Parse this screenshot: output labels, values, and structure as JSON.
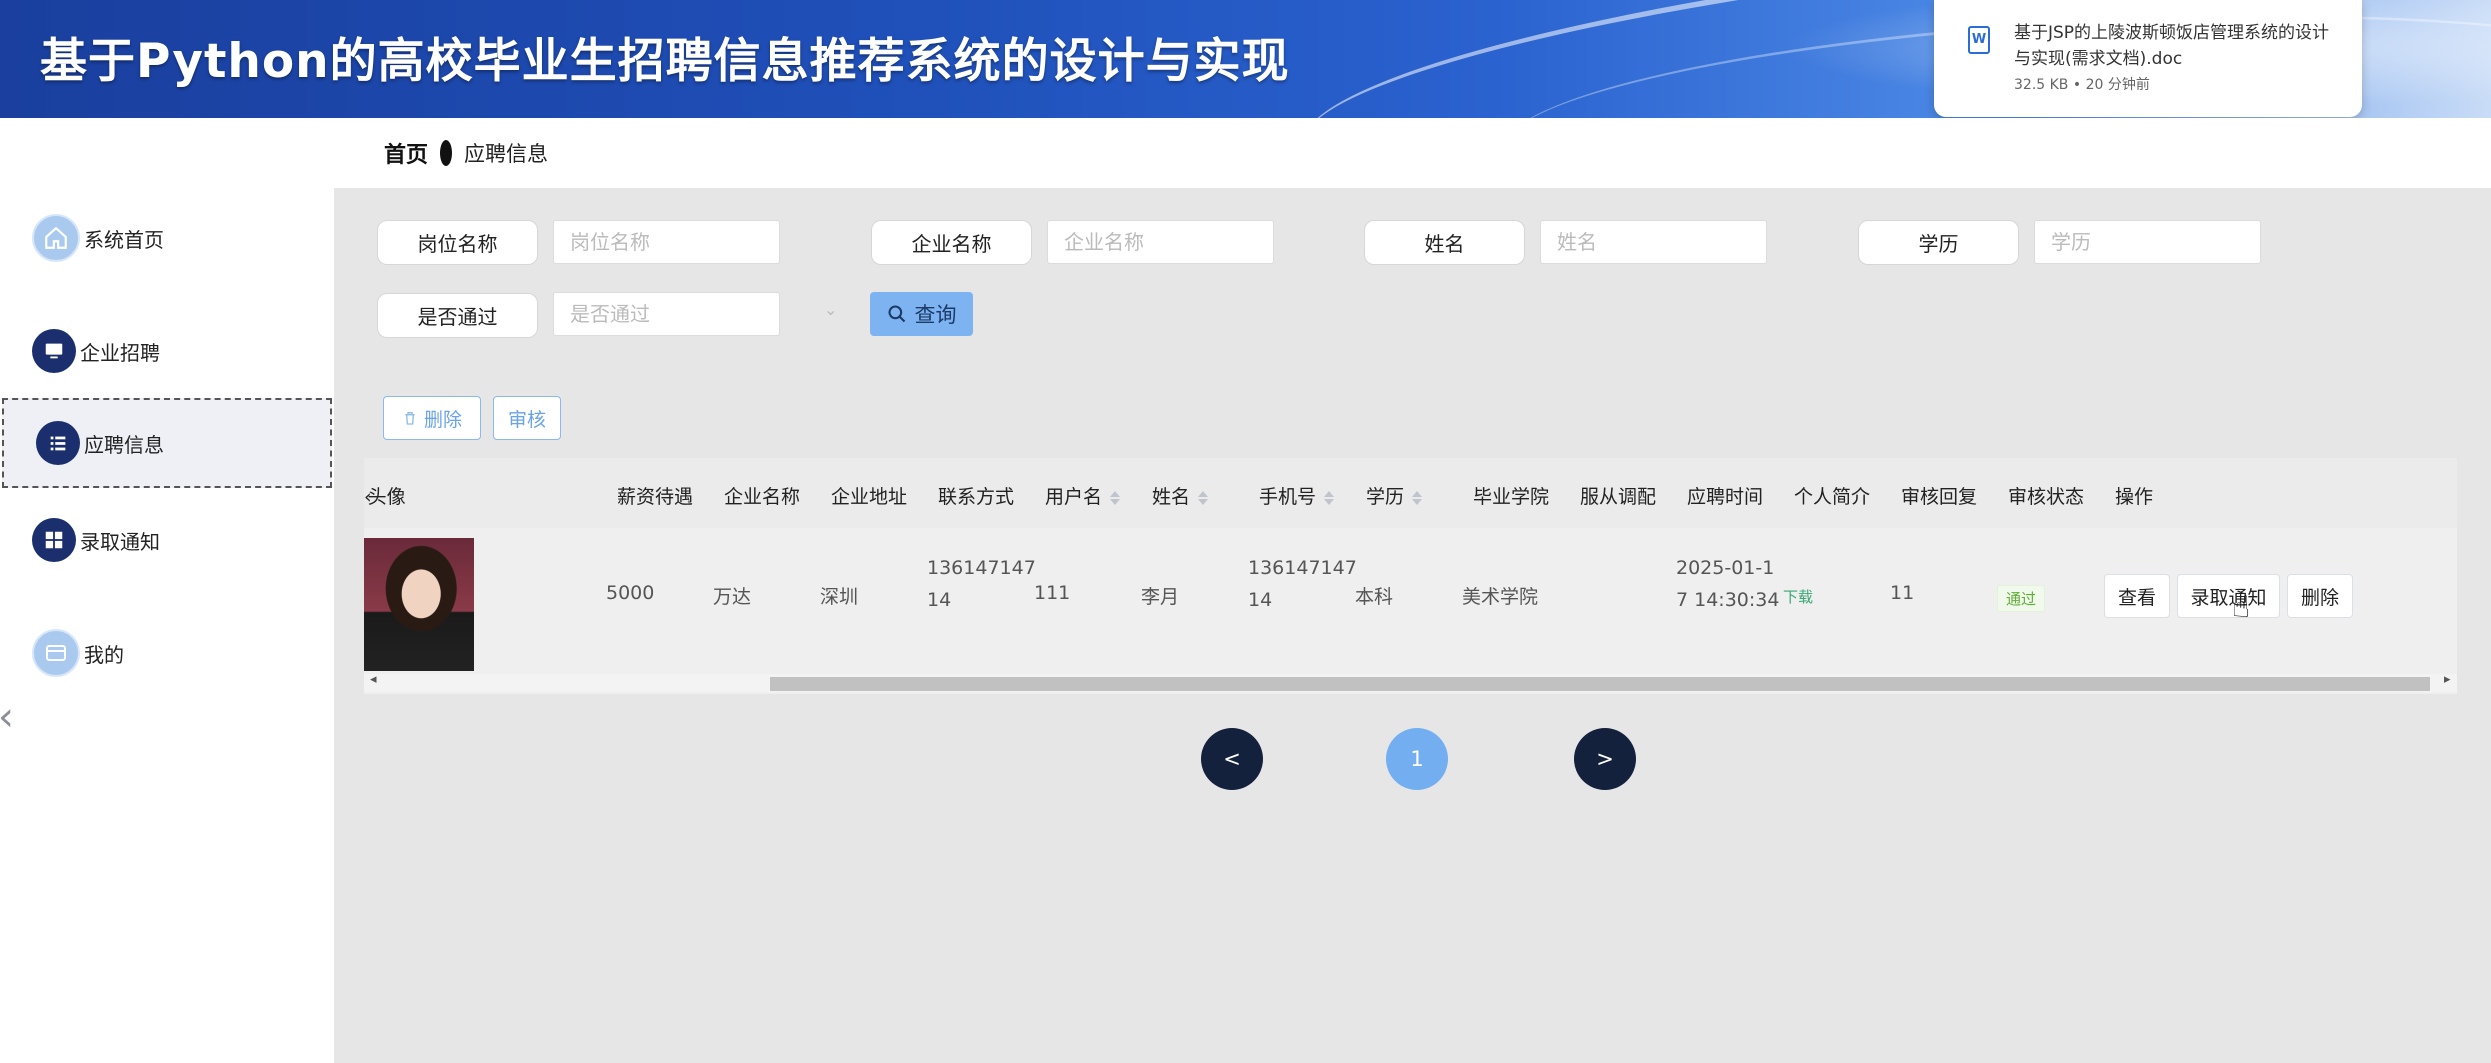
{
  "header": {
    "title": "基于Python的高校毕业生招聘信息推荐系统的设计与实现"
  },
  "download": {
    "icon": "word-file-icon",
    "filename": "基于JSP的上陵波斯顿饭店管理系统的设计与实现(需求文档).doc",
    "meta": "32.5 KB • 20 分钟前"
  },
  "breadcrumb": {
    "home": "首页",
    "current": "应聘信息"
  },
  "sidebar": {
    "items": [
      {
        "label": "系统首页",
        "icon": "home-icon"
      },
      {
        "label": "企业招聘",
        "icon": "monitor-icon"
      },
      {
        "label": "应聘信息",
        "icon": "list-icon"
      },
      {
        "label": "录取通知",
        "icon": "grid-icon"
      },
      {
        "label": "我的",
        "icon": "profile-card-icon"
      }
    ]
  },
  "search": {
    "fields": [
      {
        "label": "岗位名称",
        "placeholder": "岗位名称"
      },
      {
        "label": "企业名称",
        "placeholder": "企业名称"
      },
      {
        "label": "姓名",
        "placeholder": "姓名"
      },
      {
        "label": "学历",
        "placeholder": "学历"
      },
      {
        "label": "是否通过",
        "placeholder": "是否通过"
      }
    ],
    "query_label": "查询"
  },
  "actions": {
    "delete_label": "删除",
    "review_label": "审核"
  },
  "table": {
    "headers": [
      "头像",
      "薪资待遇",
      "企业名称",
      "企业地址",
      "联系方式",
      "用户名",
      "姓名",
      "手机号",
      "学历",
      "毕业学院",
      "服从调配",
      "应聘时间",
      "个人简介",
      "审核回复",
      "审核状态",
      "操作"
    ],
    "row": {
      "salary": "5000",
      "company": "万达",
      "address": "深圳",
      "contact_l1": "136147147",
      "contact_l2": "14",
      "username": "111",
      "name": "李月",
      "phone_l1": "136147147",
      "phone_l2": "14",
      "education": "本科",
      "college": "美术学院",
      "obey": "",
      "time_l1": "2025-01-1",
      "time_l2": "7 14:30:34",
      "intro": "下载",
      "reply": "11",
      "status": "通过",
      "ops": [
        "查看",
        "录取通知",
        "删除"
      ]
    }
  },
  "pagination": {
    "prev": "<",
    "current": "1",
    "next": ">"
  }
}
